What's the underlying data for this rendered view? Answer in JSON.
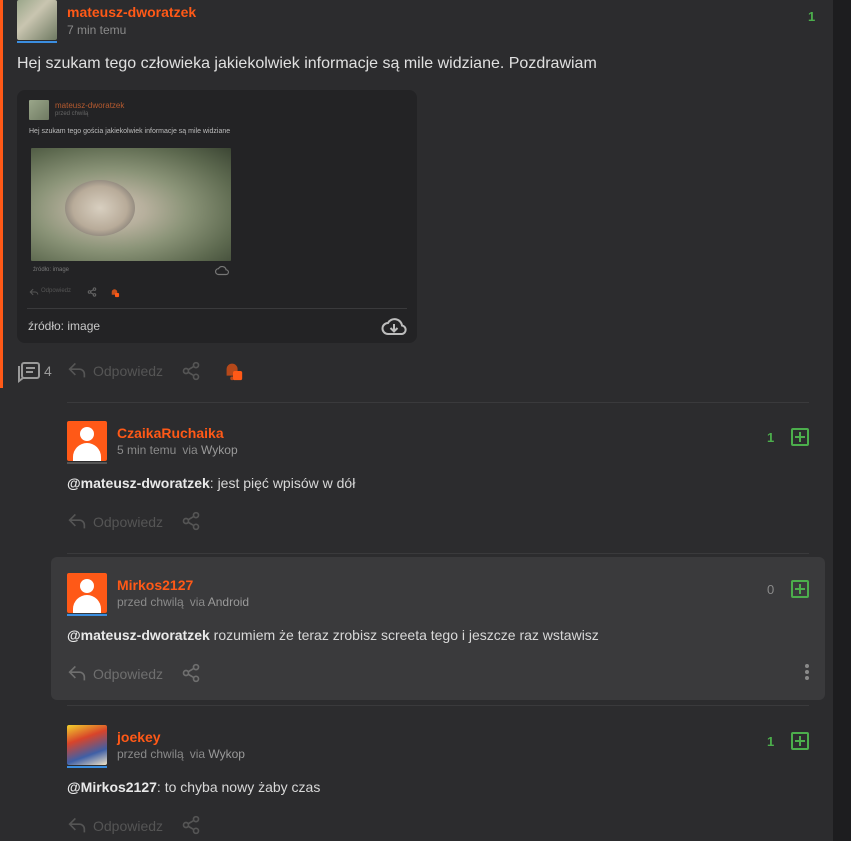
{
  "post": {
    "username": "mateusz-dworatzek",
    "time": "7 min temu",
    "vote_count": "1",
    "text": "Hej szukam tego człowieka jakiekolwiek informacje są mile widziane. Pozdrawiam",
    "comments_count": "4",
    "reply_label": "Odpowiedz",
    "embed": {
      "mini_username": "mateusz-dworatzek",
      "mini_time": "przed chwilą",
      "mini_text": "Hej szukam tego gościa jakiekolwiek informacje są mile widziane",
      "mini_source": "źródło: image",
      "mini_reply": "Odpowiedz",
      "source_label": "źródło: image"
    }
  },
  "comments": [
    {
      "username": "CzaikaRuchaika",
      "time": "5 min temu",
      "via_prefix": "via",
      "via": "Wykop",
      "vote_count": "1",
      "mention": "@mateusz-dworatzek",
      "text": ": jest pięć wpisów w dół",
      "reply_label": "Odpowiedz"
    },
    {
      "username": "Mirkos2127",
      "time": "przed chwilą",
      "via_prefix": "via",
      "via": "Android",
      "vote_count": "0",
      "mention": "@mateusz-dworatzek",
      "text": " rozumiem że teraz zrobisz screeta tego i jeszcze raz wstawisz",
      "reply_label": "Odpowiedz"
    },
    {
      "username": "joekey",
      "time": "przed chwilą",
      "via_prefix": "via",
      "via": "Wykop",
      "vote_count": "1",
      "mention": "@Mirkos2127",
      "text": ": to chyba nowy żaby czas",
      "reply_label": "Odpowiedz"
    }
  ],
  "colors": {
    "accent": "#ff5917",
    "vote_green": "#4cae4c",
    "background": "#2c2c2e",
    "card": "#232325",
    "highlight": "#3a3a3c"
  },
  "icons": [
    "comments-icon",
    "reply-icon",
    "share-icon",
    "bell-icon",
    "plus-icon",
    "cloud-download-icon",
    "kebab-menu-icon"
  ]
}
